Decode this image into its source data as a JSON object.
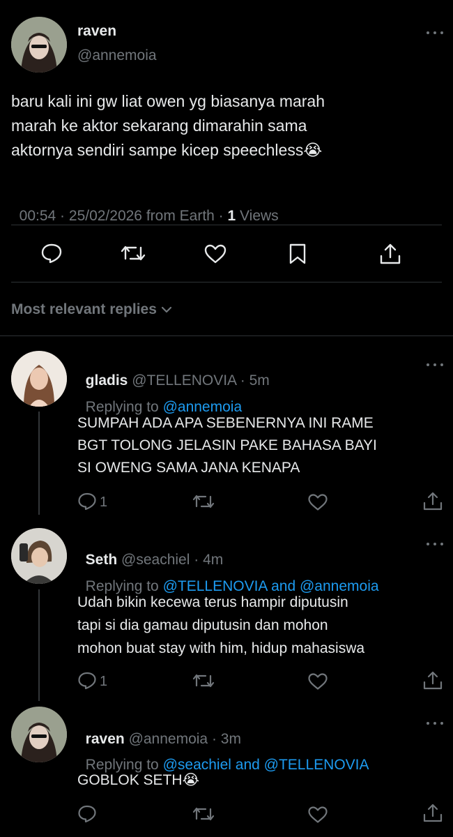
{
  "main_tweet": {
    "display_name": "raven",
    "handle": "@annemoia",
    "text_lines": [
      "baru kali ini gw liat owen yg biasanya marah",
      "marah ke aktor sekarang dimarahin sama",
      "aktornya sendiri sampe kicep speechless😭"
    ],
    "meta_prefix": "00:54 · 25/02/2026 from Earth · ",
    "views_count": "1",
    "views_label": " Views"
  },
  "replies_header": {
    "label": "Most relevant replies"
  },
  "replies": [
    {
      "display_name": "gladis",
      "handle": "@TELLENOVIA",
      "time": " · 5m",
      "replying_prefix": "Replying to ",
      "replying_to": "@annemoia",
      "text_lines": [
        "SUMPAH ADA APA SEBENERNYA INI RAME",
        "BGT TOLONG JELASIN PAKE BAHASA BAYI",
        "SI OWENG SAMA JANA KENAPA"
      ],
      "reply_count": "1"
    },
    {
      "display_name": "Seth",
      "handle": "@seachiel",
      "time": " · 4m",
      "replying_prefix": "Replying to ",
      "replying_to": "@TELLENOVIA and @annemoia",
      "text_lines": [
        "Udah bikin kecewa terus hampir diputusin",
        "tapi si dia gamau diputusin dan mohon",
        "mohon buat stay with him, hidup mahasiswa"
      ],
      "reply_count": "1"
    },
    {
      "display_name": "raven",
      "handle": "@annemoia",
      "time": " · 3m",
      "replying_prefix": "Replying to ",
      "replying_to": "@seachiel and @TELLENOVIA",
      "text_lines": [
        "GOBLOK SETH😭"
      ],
      "reply_count": ""
    }
  ],
  "colors": {
    "background": "#000000",
    "text": "#e7e9ea",
    "muted": "#71767b",
    "link": "#1d9bf0",
    "divider": "#2f3336"
  },
  "icons": {
    "reply": "reply-icon",
    "retweet": "retweet-icon",
    "like": "like-icon",
    "bookmark": "bookmark-icon",
    "share": "share-icon",
    "more": "more-icon",
    "chevron": "chevron-down-icon"
  }
}
